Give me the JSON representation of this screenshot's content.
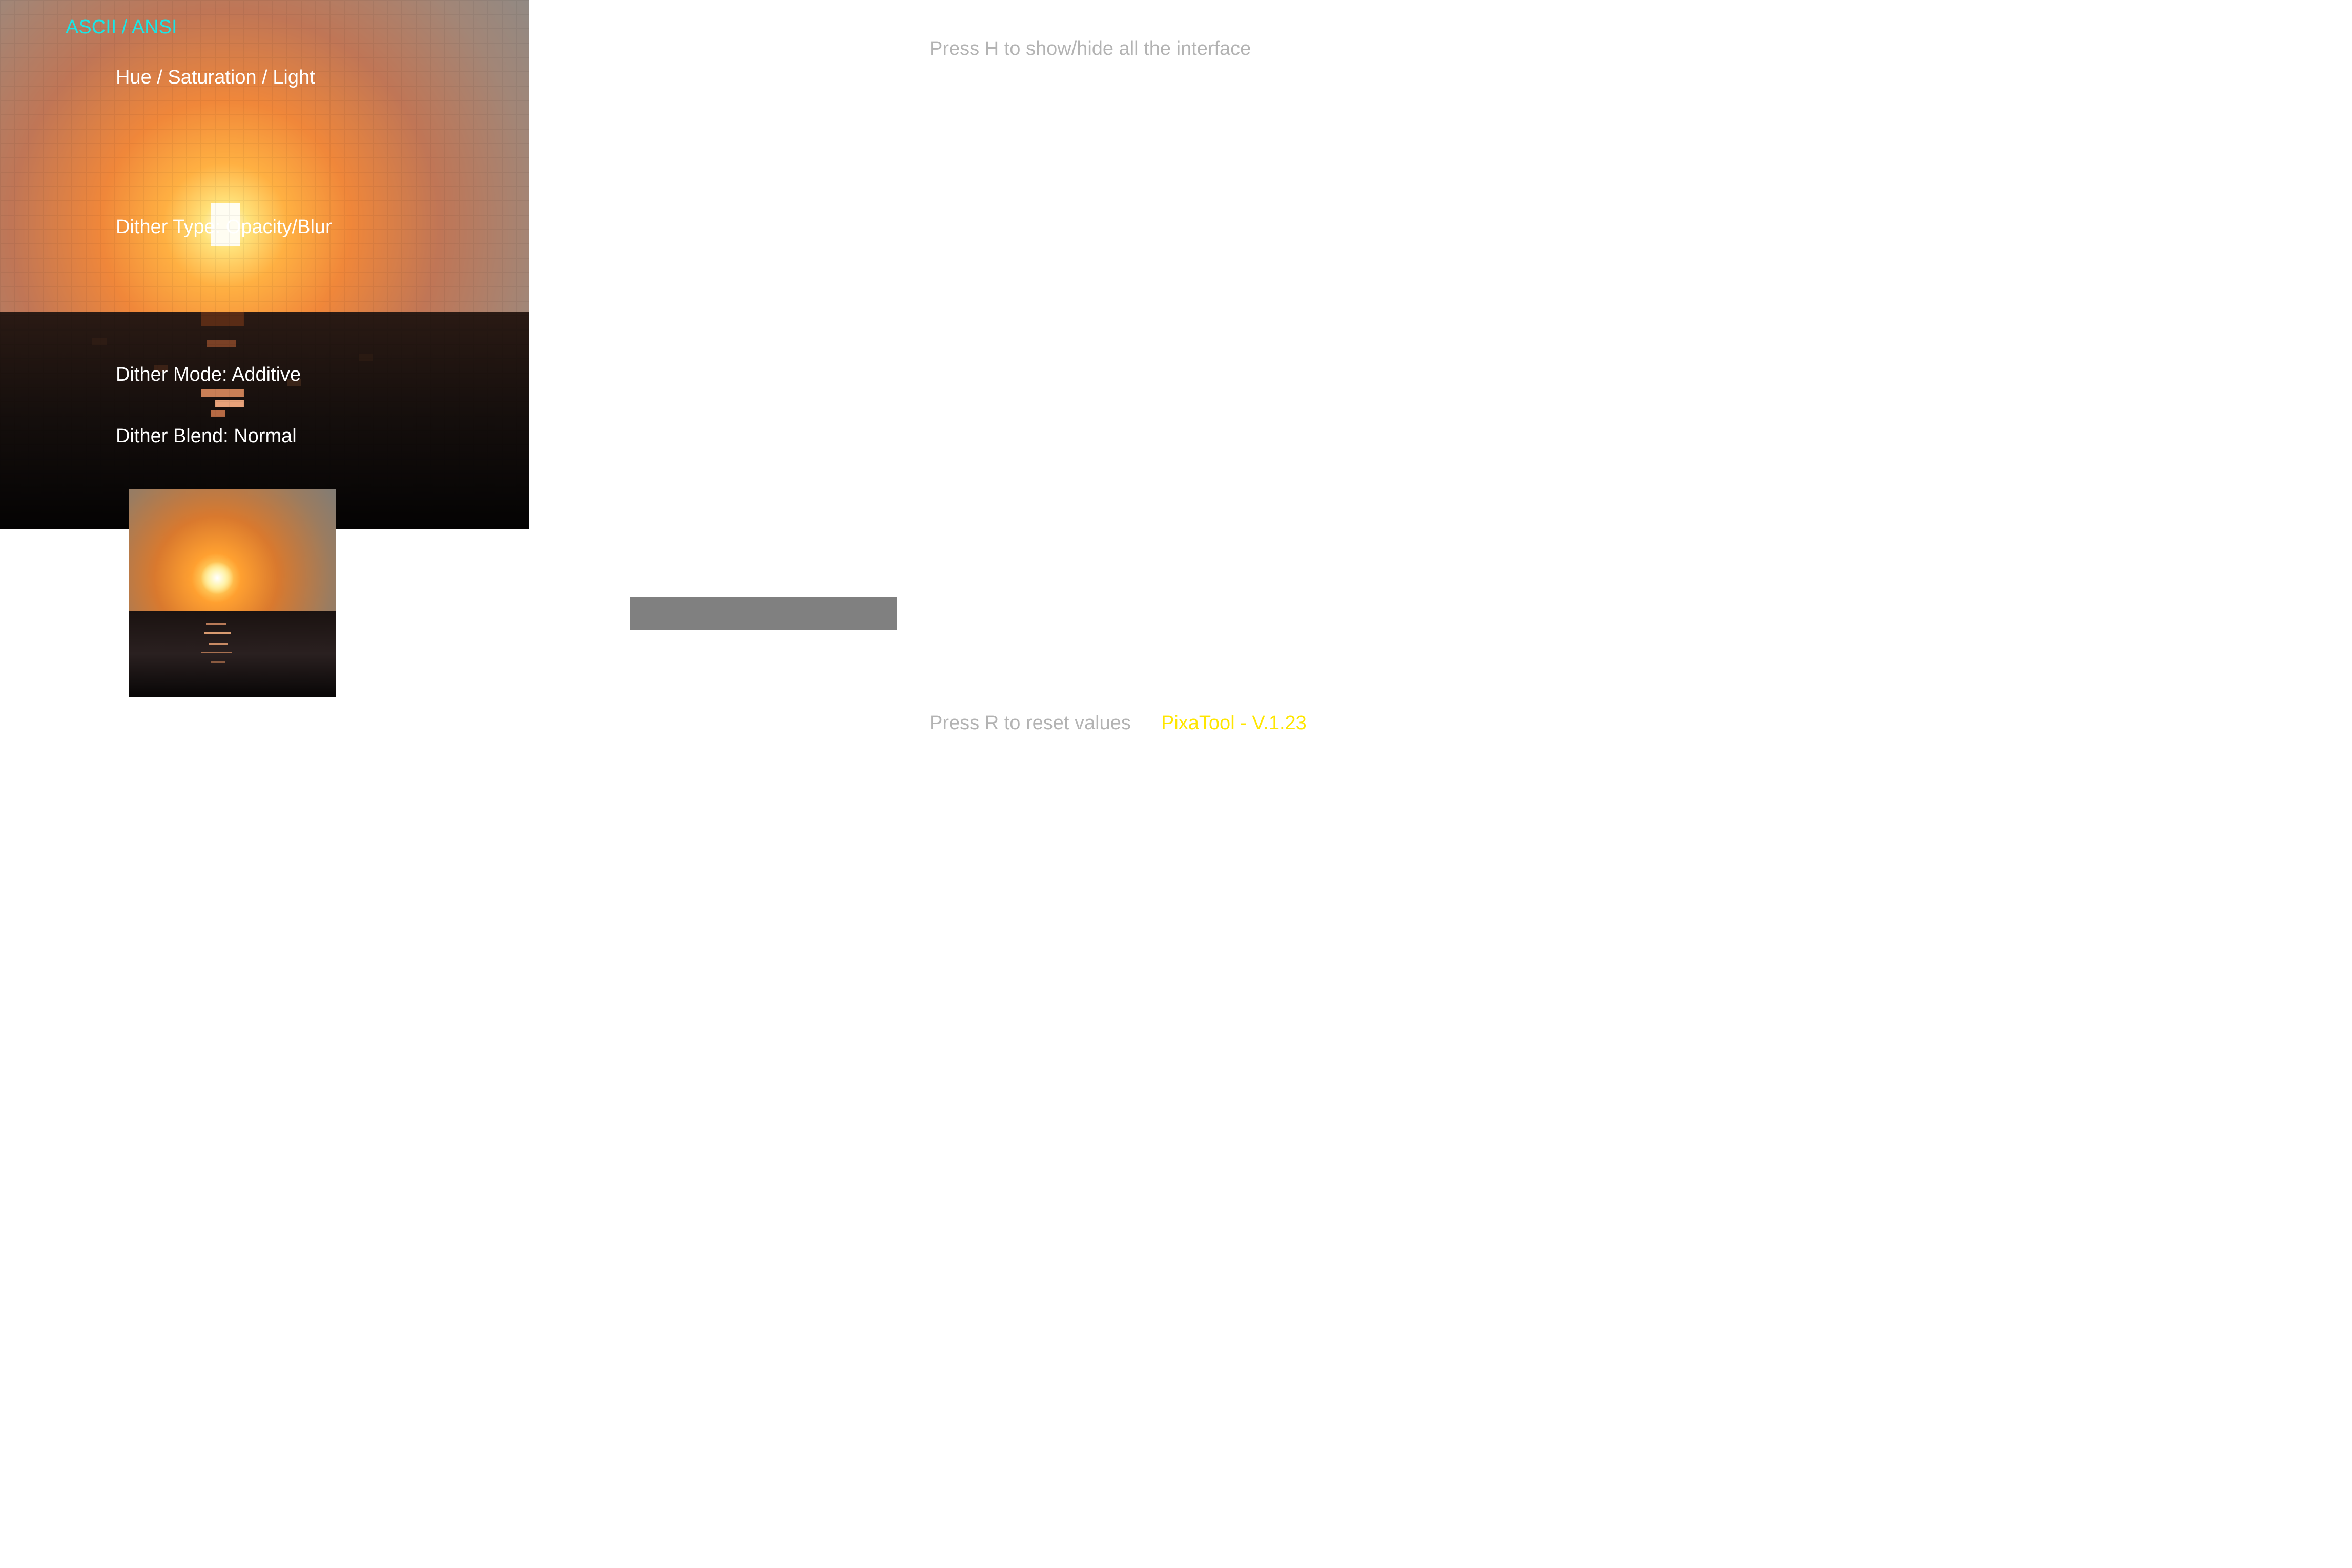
{
  "app": {
    "name": "PixaTool",
    "version_text": "PixaTool - V.1.23",
    "accent_version": "#ffe600"
  },
  "panel": {
    "mode_label": "ASCII / ANSI",
    "mode_color": "#19e6e6",
    "hsl_label": "Hue / Saturation / Light",
    "dither_type_label": "Dither Type: Opacity/Blur",
    "dither_mode_label": "Dither Mode: Additive",
    "dither_blend_label": "Dither Blend: Normal"
  },
  "hints": {
    "toggle_interface": "Press H to show/hide all the interface",
    "reset_values": "Press R to reset values"
  },
  "progress": {
    "value": 1.0,
    "color": "#808080"
  },
  "images": {
    "preview": "pixelated-sunset-over-sea",
    "source_thumbnail": "sunset-over-sea-photo"
  }
}
